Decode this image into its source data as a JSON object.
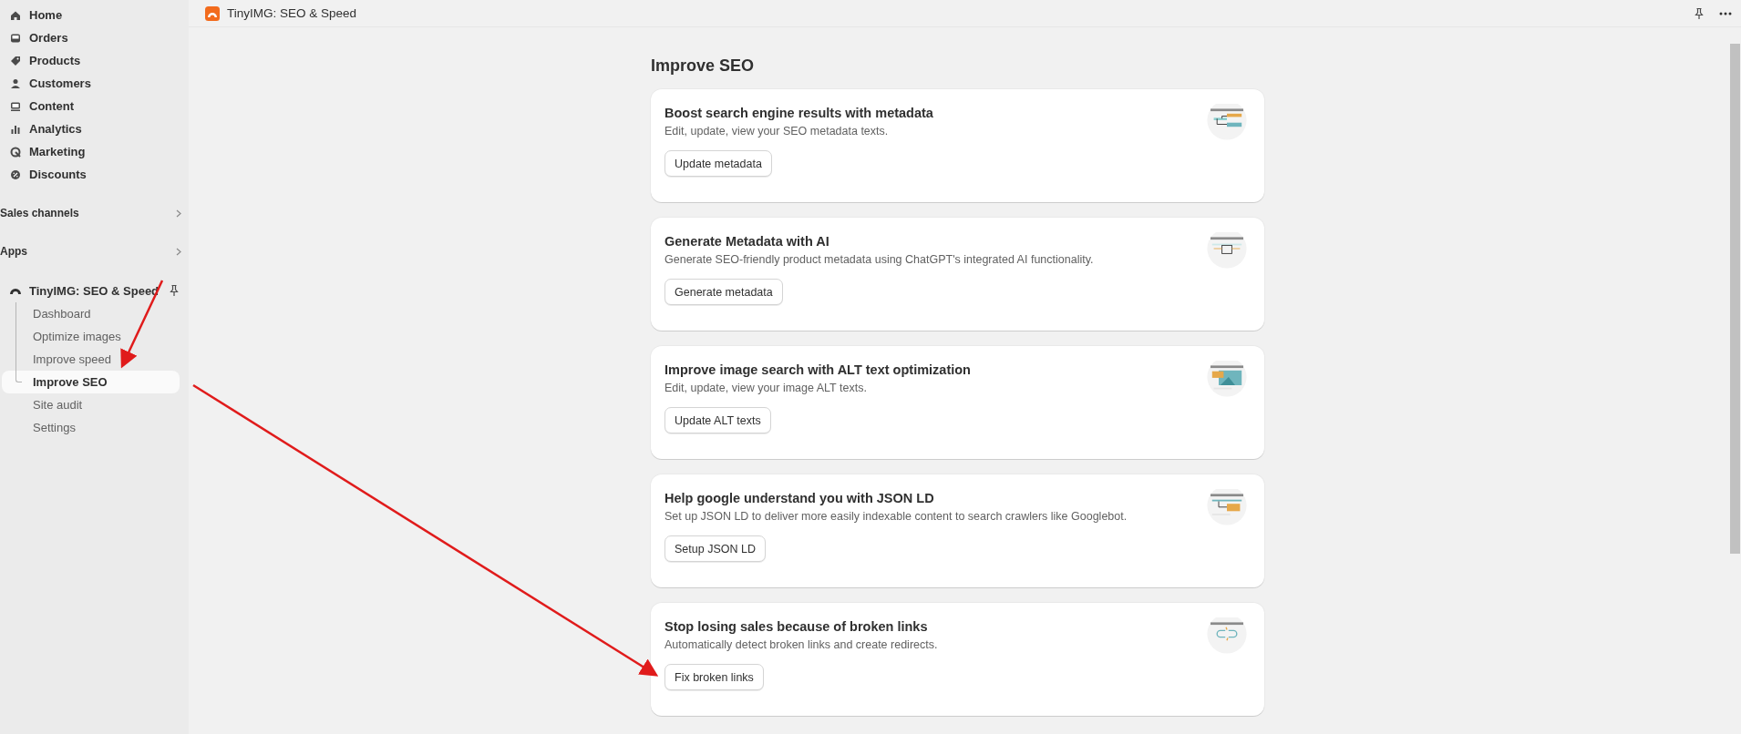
{
  "sidebar": {
    "items": [
      {
        "label": "Home",
        "selected": false
      },
      {
        "label": "Orders",
        "selected": false
      },
      {
        "label": "Products",
        "selected": false
      },
      {
        "label": "Customers",
        "selected": false
      },
      {
        "label": "Content",
        "selected": false
      },
      {
        "label": "Analytics",
        "selected": false
      },
      {
        "label": "Marketing",
        "selected": false
      },
      {
        "label": "Discounts",
        "selected": false
      }
    ],
    "sections": [
      {
        "label": "Sales channels"
      },
      {
        "label": "Apps"
      }
    ],
    "app": {
      "label": "TinyIMG: SEO & Speed",
      "children": [
        {
          "label": "Dashboard",
          "selected": false
        },
        {
          "label": "Optimize images",
          "selected": false
        },
        {
          "label": "Improve speed",
          "selected": false
        },
        {
          "label": "Improve SEO",
          "selected": true
        },
        {
          "label": "Site audit",
          "selected": false
        },
        {
          "label": "Settings",
          "selected": false
        }
      ]
    }
  },
  "topbar": {
    "title": "TinyIMG: SEO & Speed"
  },
  "page": {
    "title": "Improve SEO",
    "cards": [
      {
        "title": "Boost search engine results with metadata",
        "description": "Edit, update, view your SEO metadata texts.",
        "button": "Update metadata"
      },
      {
        "title": "Generate Metadata with AI",
        "description": "Generate SEO-friendly product metadata using ChatGPT's integrated AI functionality.",
        "button": "Generate metadata"
      },
      {
        "title": "Improve image search with ALT text optimization",
        "description": "Edit, update, view your image ALT texts.",
        "button": "Update ALT texts"
      },
      {
        "title": "Help google understand you with JSON LD",
        "description": "Set up JSON LD to deliver more easily indexable content to search crawlers like Googlebot.",
        "button": "Setup JSON LD"
      },
      {
        "title": "Stop losing sales because of broken links",
        "description": "Automatically detect broken links and create redirects.",
        "button": "Fix broken links"
      }
    ]
  }
}
